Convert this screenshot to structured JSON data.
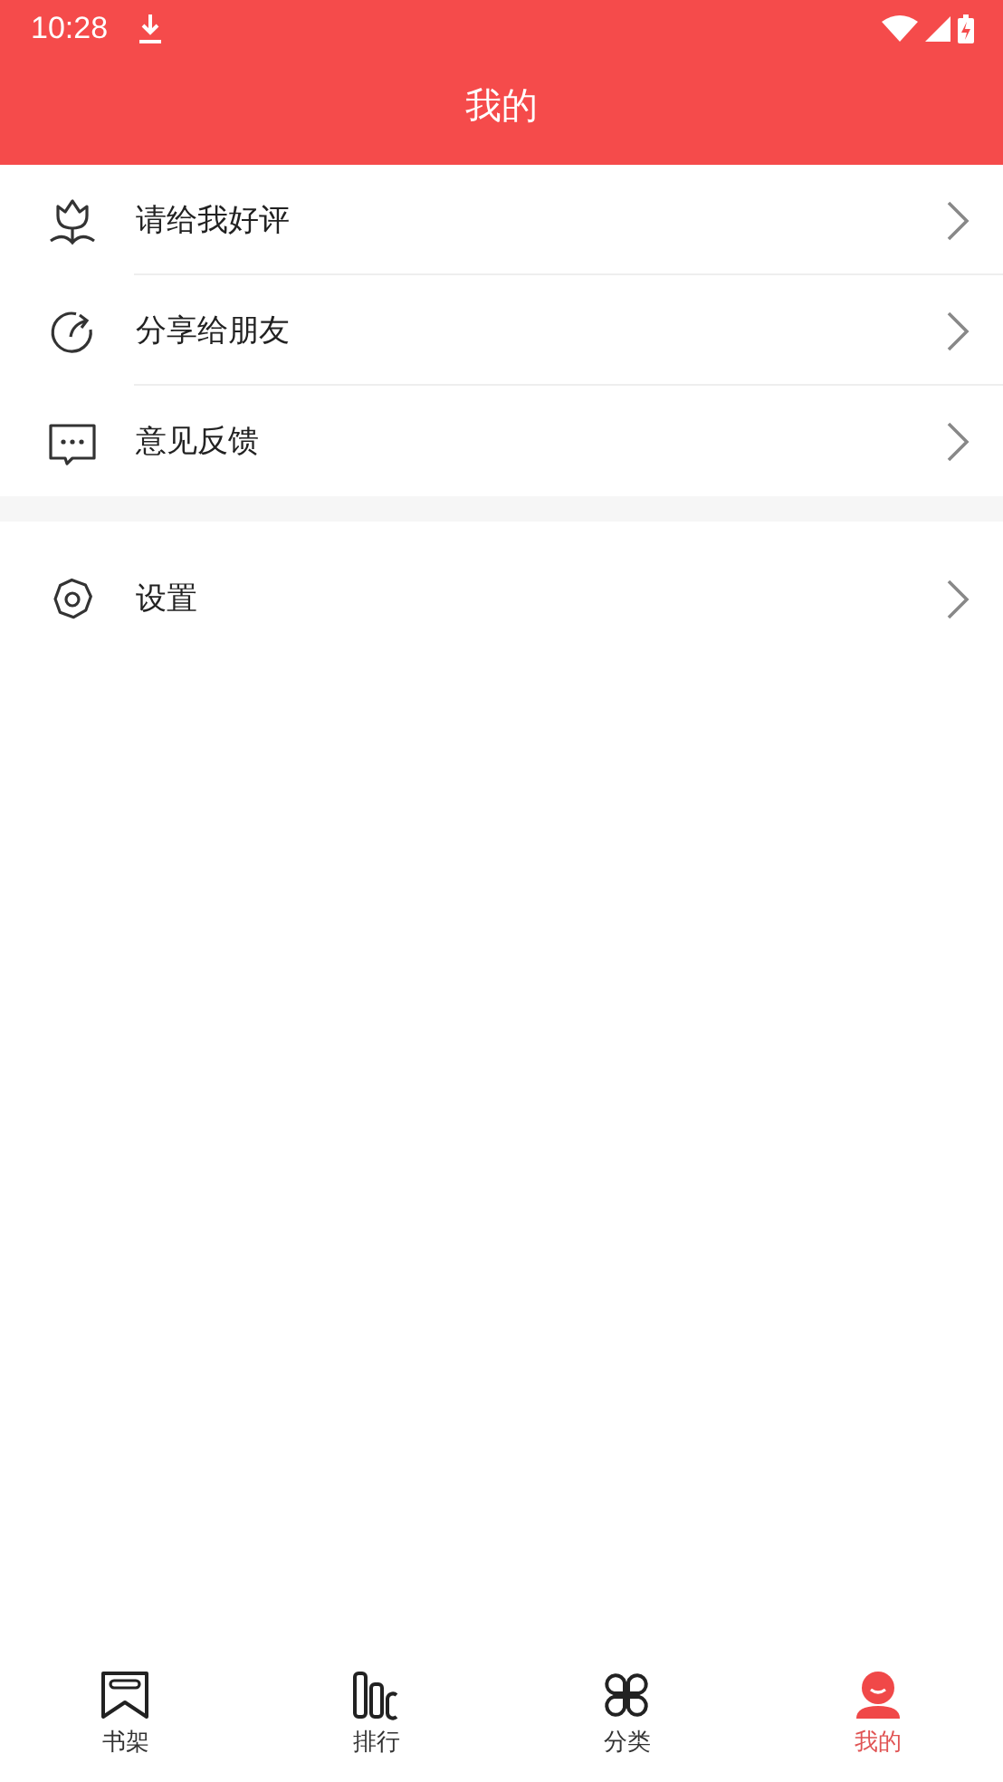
{
  "status_bar": {
    "time": "10:28"
  },
  "header": {
    "title": "我的"
  },
  "menu_groups": [
    {
      "items": [
        {
          "kind": "rate",
          "label": "请给我好评"
        },
        {
          "kind": "share",
          "label": "分享给朋友"
        },
        {
          "kind": "feedback",
          "label": "意见反馈"
        }
      ]
    },
    {
      "items": [
        {
          "kind": "settings",
          "label": "设置"
        }
      ]
    }
  ],
  "bottom_nav": [
    {
      "kind": "shelf",
      "label": "书架",
      "selected": false
    },
    {
      "kind": "rank",
      "label": "排行",
      "selected": false
    },
    {
      "kind": "category",
      "label": "分类",
      "selected": false
    },
    {
      "kind": "profile",
      "label": "我的",
      "selected": true
    }
  ]
}
